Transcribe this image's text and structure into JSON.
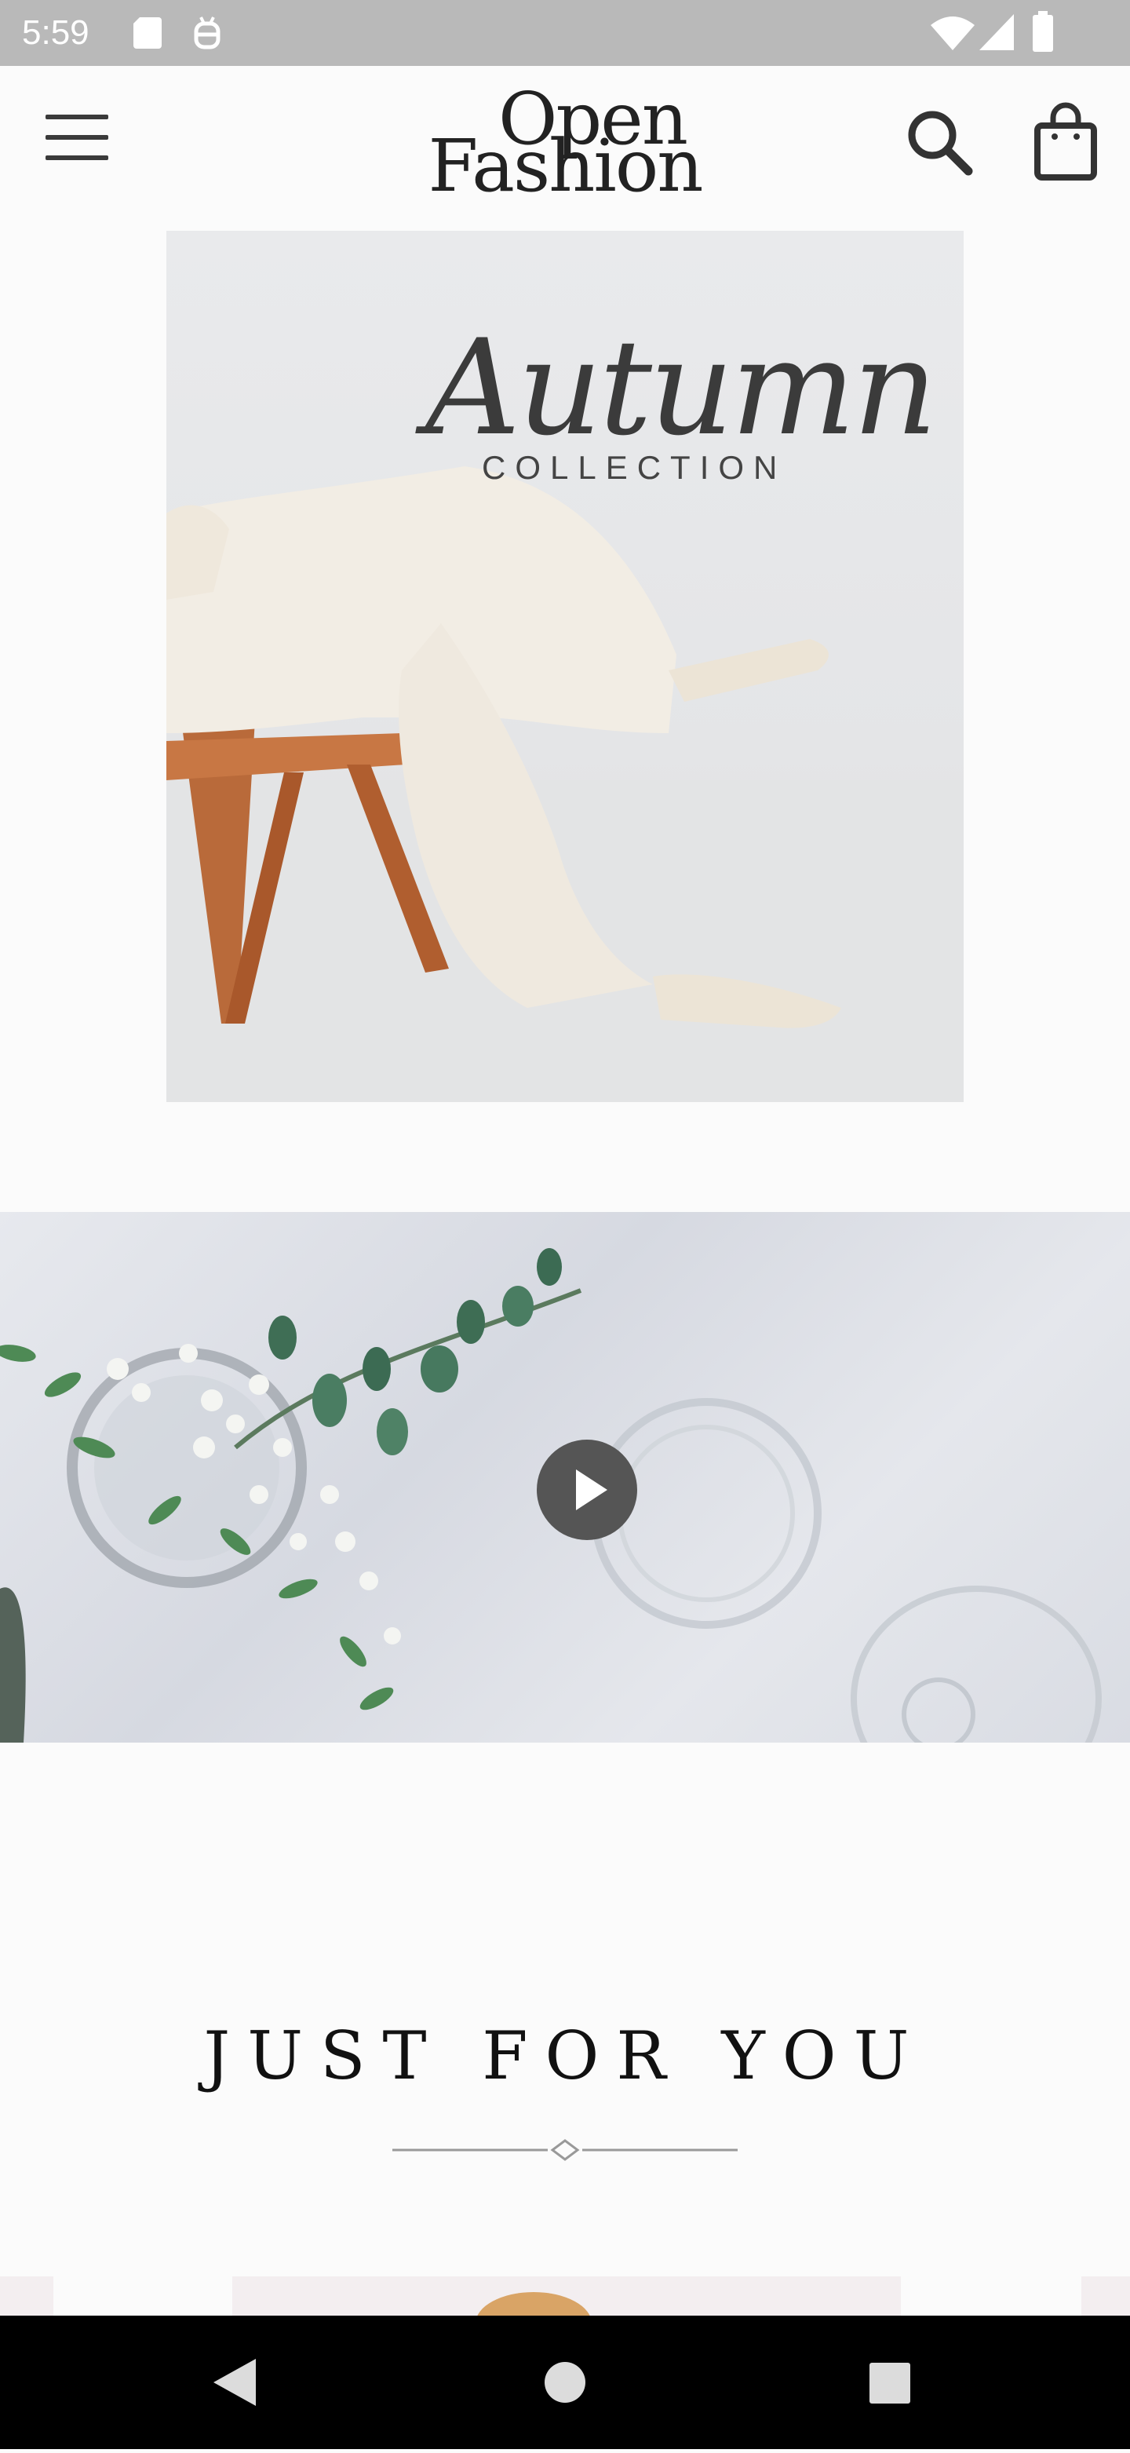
{
  "status_bar": {
    "time": "5:59",
    "icons": [
      "sd-card-icon",
      "android-debug-icon",
      "wifi-icon",
      "signal-icon",
      "battery-icon"
    ]
  },
  "app_bar": {
    "menu_icon": "hamburger-menu-icon",
    "logo_line1": "Open",
    "logo_line2": "Fashion",
    "search_icon": "search-icon",
    "bag_icon": "shopping-bag-icon"
  },
  "hero": {
    "title": "Autumn",
    "subtitle": "COLLECTION"
  },
  "video": {
    "play_icon": "play-icon"
  },
  "section": {
    "title": "JUST FOR YOU"
  },
  "nav_bar": {
    "icons": [
      "back-icon",
      "home-icon",
      "recents-icon"
    ]
  },
  "colors": {
    "background": "#fbfbfb",
    "status_bar": "#b9b9b9",
    "text": "#111111",
    "nav_bar": "#000000"
  }
}
